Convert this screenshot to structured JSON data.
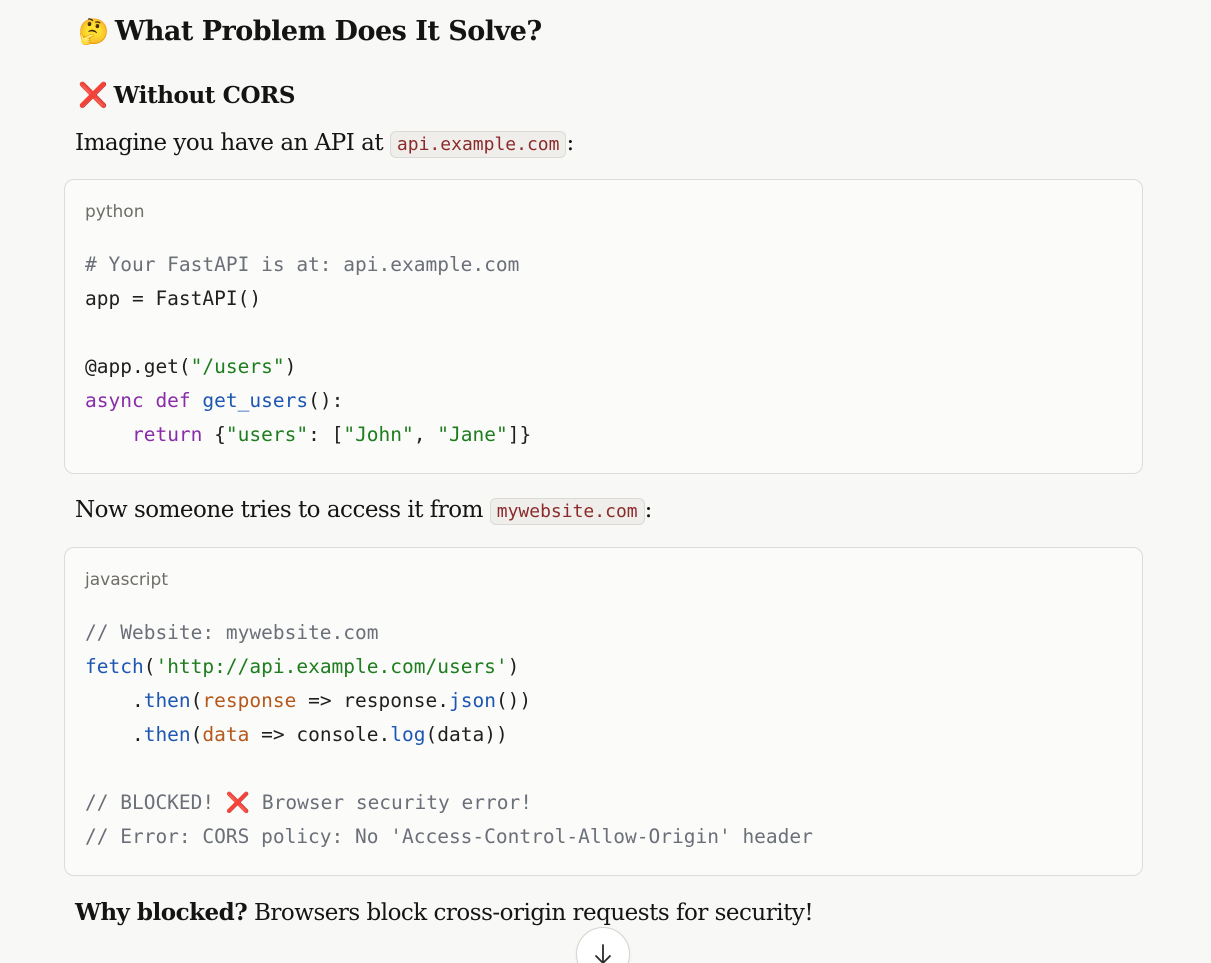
{
  "section": {
    "heading_emoji": "🤔",
    "heading": "What Problem Does It Solve?",
    "subheading_emoji": "❌",
    "subheading": "Without CORS"
  },
  "para1": {
    "before": "Imagine you have an API at ",
    "code": "api.example.com",
    "after": ":"
  },
  "code_python": {
    "language": "python",
    "l1": "# Your FastAPI is at: api.example.com",
    "l2": "app = FastAPI()",
    "l4_a": "@app.get(",
    "l4_str": "\"/users\"",
    "l4_b": ")",
    "l5_kw": "async def",
    "l5_sp": " ",
    "l5_fn": "get_users",
    "l5_b": "():",
    "l6_indent": "    ",
    "l6_kw": "return",
    "l6_a": " {",
    "l6_s1": "\"users\"",
    "l6_b": ": [",
    "l6_s2": "\"John\"",
    "l6_c": ", ",
    "l6_s3": "\"Jane\"",
    "l6_d": "]}"
  },
  "para2": {
    "before": "Now someone tries to access it from ",
    "code": "mywebsite.com",
    "after": ":"
  },
  "code_js": {
    "language": "javascript",
    "l1": "// Website: mywebsite.com",
    "l2_fn": "fetch",
    "l2_a": "(",
    "l2_str": "'http://api.example.com/users'",
    "l2_b": ")",
    "l3_a": "    .",
    "l3_fn": "then",
    "l3_b": "(",
    "l3_param": "response",
    "l3_c": " => response.",
    "l3_fn2": "json",
    "l3_d": "())",
    "l4_a": "    .",
    "l4_fn": "then",
    "l4_b": "(",
    "l4_param": "data",
    "l4_c": " => console.",
    "l4_fn2": "log",
    "l4_d": "(data))",
    "l6_a": "// BLOCKED! ",
    "l6_x": "❌",
    "l6_b": " Browser security error!",
    "l7": "// Error: CORS policy: No 'Access-Control-Allow-Origin' header"
  },
  "para3": {
    "bold": "Why blocked?",
    "rest": " Browsers block cross-origin requests for security!"
  },
  "colors": {
    "background": "#f8f8f6",
    "inline_code_text": "#8b2a2a",
    "comment": "#6b6f78",
    "keyword": "#8a2ca8",
    "function": "#1d56b3",
    "string": "#1e7d1e",
    "param": "#b5581c"
  },
  "icons": {
    "scroll_down": "arrow-down-icon"
  }
}
